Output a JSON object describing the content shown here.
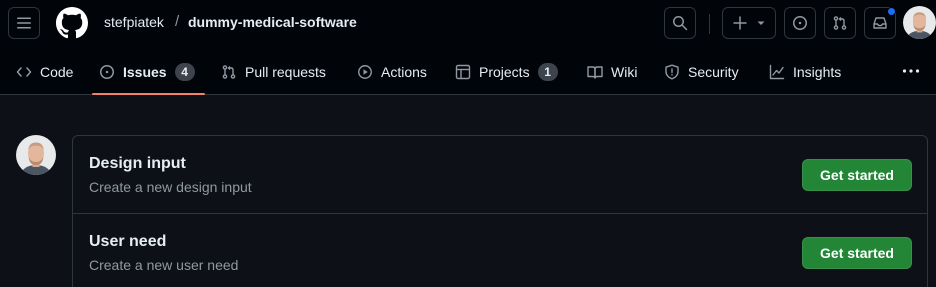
{
  "header": {
    "owner": "stefpiatek",
    "separator": "/",
    "repo": "dummy-medical-software",
    "icons": [
      "hamburger-icon",
      "github-logo-icon",
      "search-icon",
      "plus-icon",
      "chevron-down-icon",
      "issue-opened-icon",
      "pull-request-icon",
      "inbox-icon"
    ]
  },
  "nav": {
    "items": [
      {
        "label": "Code",
        "icon": "code-icon"
      },
      {
        "label": "Issues",
        "icon": "issue-opened-icon",
        "counter": "4",
        "selected": true
      },
      {
        "label": "Pull requests",
        "icon": "git-pull-request-icon"
      },
      {
        "label": "Actions",
        "icon": "play-icon"
      },
      {
        "label": "Projects",
        "icon": "table-icon",
        "counter": "1"
      },
      {
        "label": "Wiki",
        "icon": "book-icon"
      },
      {
        "label": "Security",
        "icon": "shield-icon"
      },
      {
        "label": "Insights",
        "icon": "graph-icon"
      }
    ],
    "more_icon": "kebab-horizontal-icon"
  },
  "templates": [
    {
      "title": "Design input",
      "description": "Create a new design input",
      "button": "Get started"
    },
    {
      "title": "User need",
      "description": "Create a new user need",
      "button": "Get started"
    }
  ],
  "colors": {
    "accent_underline": "#f78166",
    "primary_button": "#238636",
    "notification_dot": "#1f6feb"
  }
}
